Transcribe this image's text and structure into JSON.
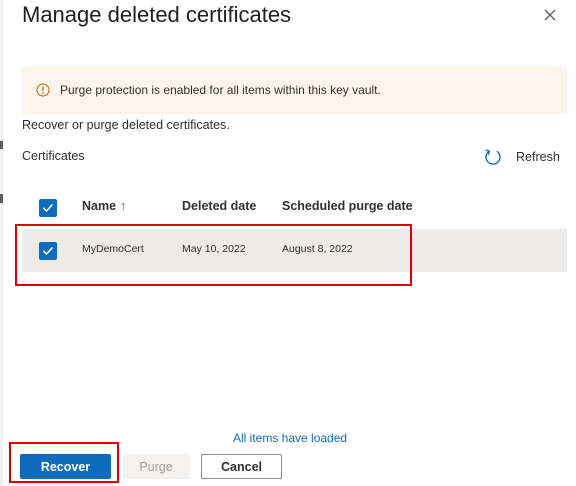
{
  "dialog": {
    "title": "Manage deleted certificates",
    "close_icon": "close-icon"
  },
  "banner": {
    "icon": "info-icon",
    "text": "Purge protection is enabled for all items within this key vault."
  },
  "description": "Recover or purge deleted certificates.",
  "section": {
    "label": "Certificates",
    "refresh_icon": "refresh-icon",
    "refresh_label": "Refresh"
  },
  "table": {
    "select_all_checked": true,
    "columns": [
      {
        "label": "Name",
        "sort_indicator": "↑"
      },
      {
        "label": "Deleted date"
      },
      {
        "label": "Scheduled purge date"
      }
    ],
    "rows": [
      {
        "selected": true,
        "name": "MyDemoCert",
        "deleted_date": "May 10, 2022",
        "scheduled_purge_date": "August 8, 2022"
      }
    ]
  },
  "status": "All items have loaded",
  "buttons": {
    "recover": "Recover",
    "purge": "Purge",
    "cancel": "Cancel"
  },
  "colors": {
    "accent": "#0f6cbd",
    "warning_background": "#fdf5ec",
    "warning_icon": "#c45e1a",
    "selected_row": "#edebe9",
    "annotation_highlight": "#e00000"
  }
}
